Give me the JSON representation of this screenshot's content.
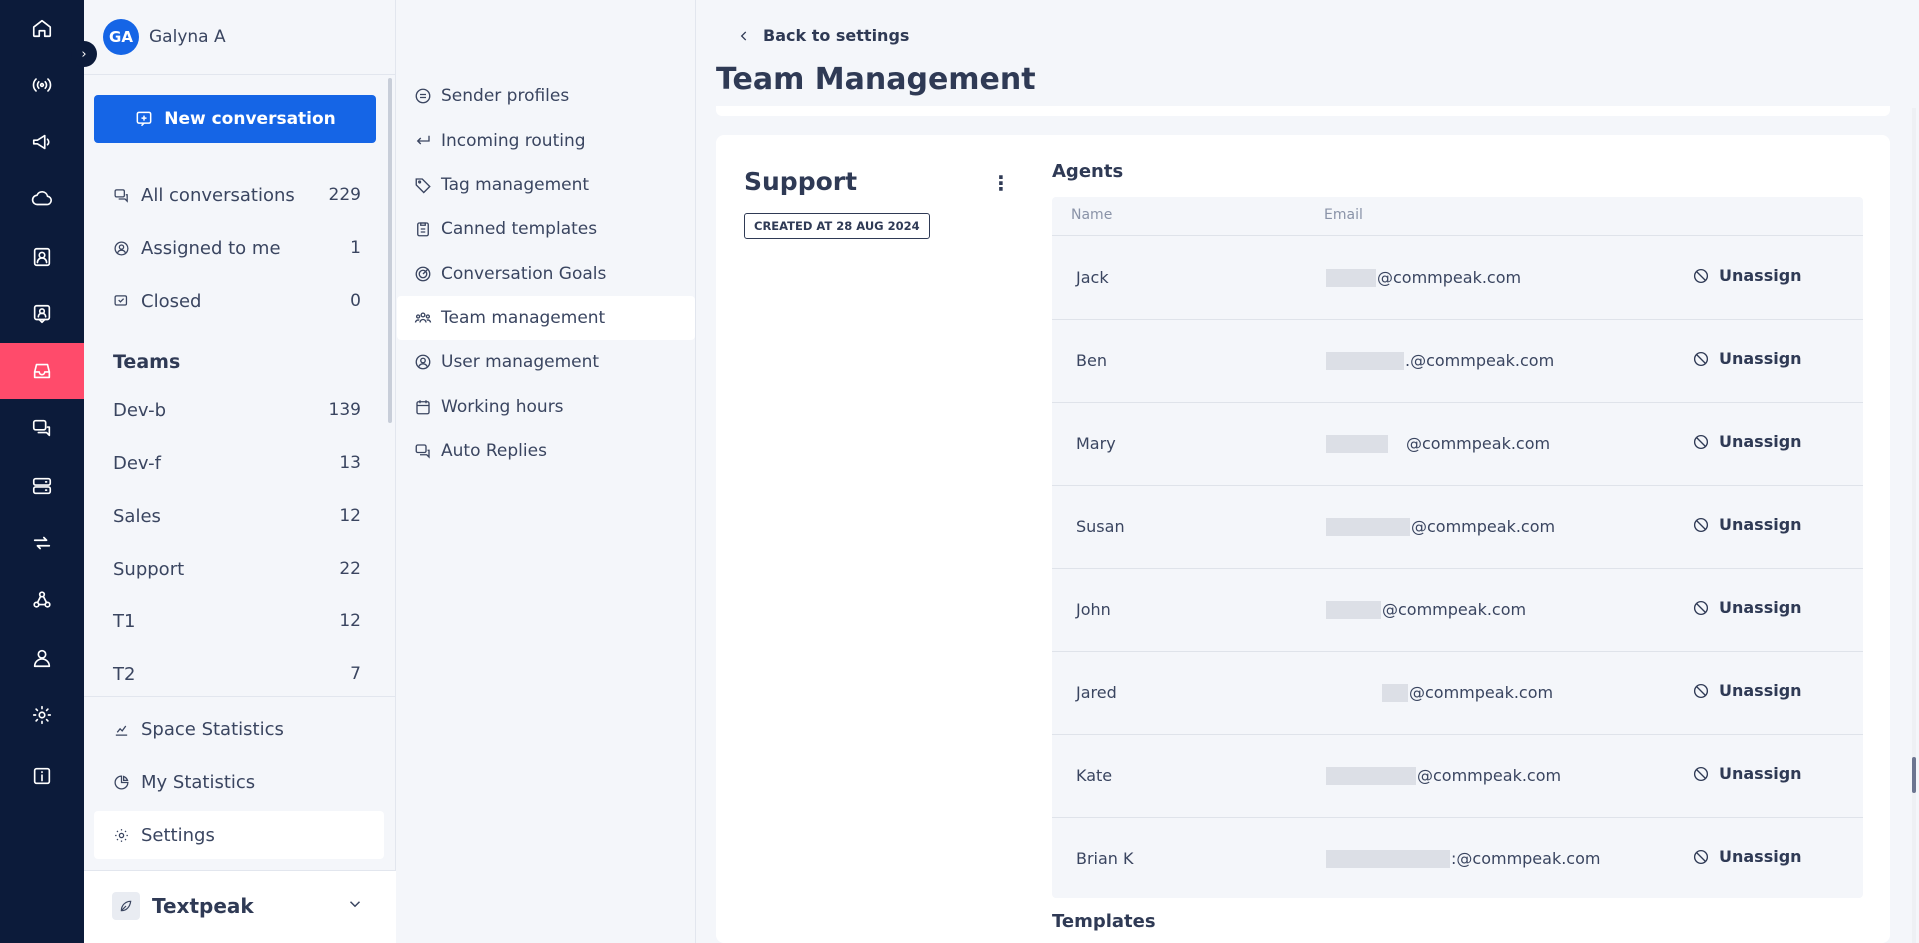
{
  "user": {
    "initials": "GA",
    "name": "Galyna A"
  },
  "nav": {
    "new_conversation": "New conversation",
    "items": [
      {
        "label": "All conversations",
        "count": "229"
      },
      {
        "label": "Assigned to me",
        "count": "1"
      },
      {
        "label": "Closed",
        "count": "0"
      }
    ],
    "teams_heading": "Teams",
    "teams": [
      {
        "label": "Dev-b",
        "count": "139"
      },
      {
        "label": "Dev-f",
        "count": "13"
      },
      {
        "label": "Sales",
        "count": "12"
      },
      {
        "label": "Support",
        "count": "22"
      },
      {
        "label": "T1",
        "count": "12"
      },
      {
        "label": "T2",
        "count": "7"
      }
    ],
    "bottom": [
      {
        "label": "Space Statistics"
      },
      {
        "label": "My Statistics"
      },
      {
        "label": "Settings"
      }
    ],
    "workspace": "Textpeak"
  },
  "submenu": {
    "items": [
      {
        "label": "Sender profiles",
        "icon": "sender-profile-icon"
      },
      {
        "label": "Incoming routing",
        "icon": "routing-icon"
      },
      {
        "label": "Tag management",
        "icon": "tag-icon"
      },
      {
        "label": "Canned templates",
        "icon": "clipboard-icon"
      },
      {
        "label": "Conversation Goals",
        "icon": "goal-icon"
      },
      {
        "label": "Team management",
        "icon": "team-icon"
      },
      {
        "label": "User management",
        "icon": "user-circle-icon"
      },
      {
        "label": "Working hours",
        "icon": "calendar-icon"
      },
      {
        "label": "Auto Replies",
        "icon": "chat-bubbles-icon"
      }
    ]
  },
  "main": {
    "back_label": "Back to settings",
    "title": "Team Management",
    "team_name": "Support",
    "created_badge": "CREATED AT 28 AUG 2024",
    "agents_heading": "Agents",
    "columns": {
      "name": "Name",
      "email": "Email"
    },
    "unassign_label": "Unassign",
    "agents": [
      {
        "name": "Jack",
        "email": "@commpeak.com"
      },
      {
        "name": "Ben",
        "email": ".@commpeak.com"
      },
      {
        "name": "Mary",
        "email": "@commpeak.com"
      },
      {
        "name": "Susan",
        "email": "@commpeak.com"
      },
      {
        "name": "John",
        "email": "@commpeak.com"
      },
      {
        "name": "Jared",
        "email": "@commpeak.com"
      },
      {
        "name": "Kate",
        "email": "@commpeak.com"
      },
      {
        "name": "Brian K",
        "email": ":@commpeak.com"
      }
    ],
    "templates_heading": "Templates"
  },
  "colors": {
    "rail": "#0c1b3a",
    "rail_active": "#ff4b6b",
    "primary": "#1565e6",
    "text": "#2f3a55"
  }
}
